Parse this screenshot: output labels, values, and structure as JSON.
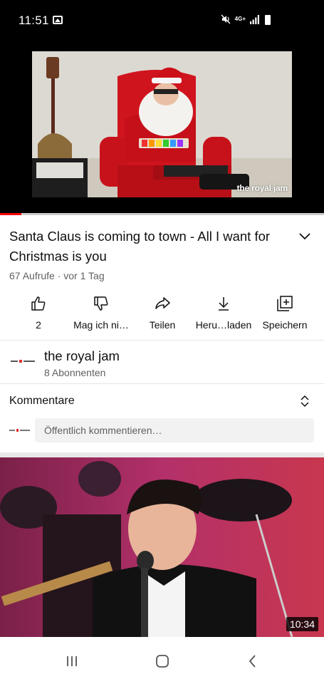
{
  "status_bar": {
    "time": "11:51",
    "network": "4G+",
    "icons": [
      "gallery-icon",
      "mute-icon",
      "signal-icon",
      "battery-icon"
    ]
  },
  "player": {
    "watermark": "the royal jam",
    "progress": 0.066,
    "colors": {
      "progress": "#ff0000",
      "track": "#cccccc"
    }
  },
  "video": {
    "title": "Santa Claus is coming to town - All I want for Christmas is you",
    "meta": "67 Aufrufe · vor 1 Tag"
  },
  "actions": [
    {
      "name": "like-button",
      "icon": "thumbs-up-icon",
      "label": "2"
    },
    {
      "name": "dislike-button",
      "icon": "thumbs-down-icon",
      "label": "Mag ich ni…"
    },
    {
      "name": "share-button",
      "icon": "share-icon",
      "label": "Teilen"
    },
    {
      "name": "download-button",
      "icon": "download-icon",
      "label": "Heru…laden"
    },
    {
      "name": "save-button",
      "icon": "add-to-playlist-icon",
      "label": "Speichern"
    }
  ],
  "channel": {
    "avatar_text": "the royal jam",
    "name": "the royal jam",
    "subscribers": "8 Abonnenten"
  },
  "comments": {
    "heading": "Kommentare",
    "avatar_text": "the royal jam",
    "placeholder": "Öffentlich kommentieren…"
  },
  "next_video": {
    "duration": "10:34"
  },
  "nav": {
    "buttons": [
      "recent-apps-icon",
      "home-icon",
      "back-icon"
    ]
  }
}
